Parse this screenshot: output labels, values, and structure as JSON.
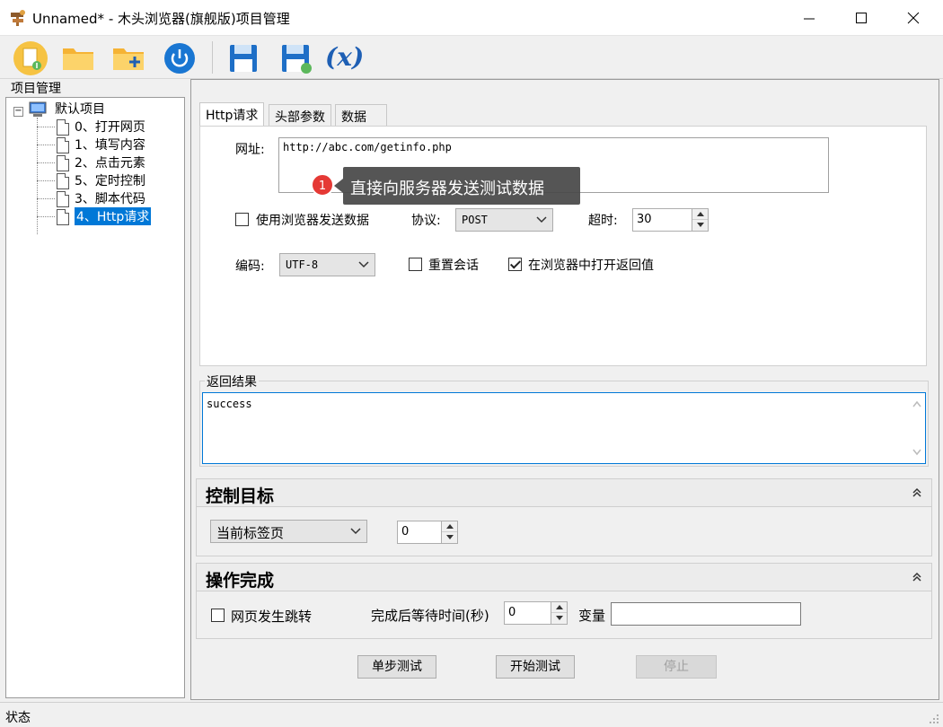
{
  "window": {
    "title": "Unnamed* - 木头浏览器(旗舰版)项目管理"
  },
  "toolbar": {
    "icons": [
      "new-file-icon",
      "open-folder-icon",
      "add-folder-icon",
      "power-icon",
      "save-icon",
      "save-as-icon",
      "variable-icon"
    ],
    "variable_label": "(x)"
  },
  "left": {
    "group_label": "项目管理",
    "root_label": "默认项目",
    "items": [
      {
        "label": "0、打开网页"
      },
      {
        "label": "1、填写内容"
      },
      {
        "label": "2、点击元素"
      },
      {
        "label": "5、定时控制"
      },
      {
        "label": "3、脚本代码"
      },
      {
        "label": "4、Http请求",
        "selected": true
      }
    ]
  },
  "tabs": [
    {
      "label": "Http请求",
      "active": true
    },
    {
      "label": "头部参数"
    },
    {
      "label": "数据"
    }
  ],
  "http": {
    "url_label": "网址:",
    "url_value": "http://abc.com/getinfo.php",
    "tooltip_badge": "1",
    "tooltip_text": "直接向服务器发送测试数据",
    "use_browser_label": "使用浏览器发送数据",
    "use_browser_checked": false,
    "protocol_label": "协议:",
    "protocol_value": "POST",
    "timeout_label": "超时:",
    "timeout_value": "30",
    "encoding_label": "编码:",
    "encoding_value": "UTF-8",
    "reset_session_label": "重置会话",
    "reset_session_checked": false,
    "open_in_browser_label": "在浏览器中打开返回值",
    "open_in_browser_checked": true
  },
  "result": {
    "label": "返回结果",
    "value": "success"
  },
  "control_target": {
    "title": "控制目标",
    "select_value": "当前标签页",
    "spin_value": "0"
  },
  "completion": {
    "title": "操作完成",
    "jump_label": "网页发生跳转",
    "jump_checked": false,
    "wait_label": "完成后等待时间(秒)",
    "wait_value": "0",
    "var_label": "变量",
    "var_value": ""
  },
  "buttons": {
    "step_test": "单步测试",
    "start_test": "开始测试",
    "stop": "停止"
  },
  "status": {
    "text": "状态"
  },
  "colors": {
    "accent": "#0078d7",
    "badge": "#e53935",
    "tooltip_bg": "#464646"
  }
}
